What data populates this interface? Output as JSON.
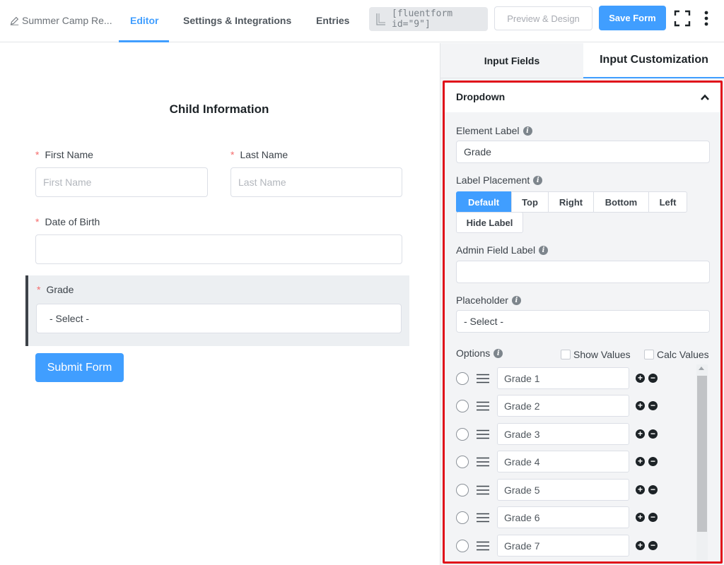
{
  "header": {
    "form_title": "Summer Camp Re...",
    "tabs": [
      {
        "label": "Editor",
        "active": true
      },
      {
        "label": "Settings & Integrations",
        "active": false
      },
      {
        "label": "Entries",
        "active": false
      }
    ],
    "shortcode": "[fluentform id=\"9\"]",
    "preview_label": "Preview & Design",
    "save_label": "Save Form",
    "icons": {
      "edit": "pencil-icon",
      "shortcode": "shortcode-icon",
      "fullscreen": "fullscreen-icon",
      "more": "more-vertical-icon"
    }
  },
  "canvas": {
    "section_title": "Child Information",
    "fields": {
      "first_name": {
        "label": "First Name",
        "placeholder": "First Name",
        "required": "*"
      },
      "last_name": {
        "label": "Last Name",
        "placeholder": "Last Name",
        "required": "*"
      },
      "dob": {
        "label": "Date of Birth",
        "placeholder": "",
        "required": "*"
      },
      "grade": {
        "label": "Grade",
        "value": "- Select -",
        "required": "*"
      }
    },
    "submit_label": "Submit Form"
  },
  "panel": {
    "tabs": [
      {
        "label": "Input Fields",
        "active": false
      },
      {
        "label": "Input Customization",
        "active": true
      }
    ],
    "section_title": "Dropdown",
    "element_label": {
      "label": "Element Label",
      "value": "Grade"
    },
    "label_placement": {
      "label": "Label Placement",
      "options": [
        "Default",
        "Top",
        "Right",
        "Bottom",
        "Left",
        "Hide Label"
      ],
      "selected": "Default"
    },
    "admin_field_label": {
      "label": "Admin Field Label",
      "value": ""
    },
    "placeholder": {
      "label": "Placeholder",
      "value": "- Select -"
    },
    "options": {
      "label": "Options",
      "show_values": "Show Values",
      "calc_values": "Calc Values",
      "items": [
        "Grade 1",
        "Grade 2",
        "Grade 3",
        "Grade 4",
        "Grade 5",
        "Grade 6",
        "Grade 7"
      ]
    }
  },
  "colors": {
    "accent": "#409eff",
    "highlight": "#e0101a",
    "required": "#f56c6c"
  }
}
